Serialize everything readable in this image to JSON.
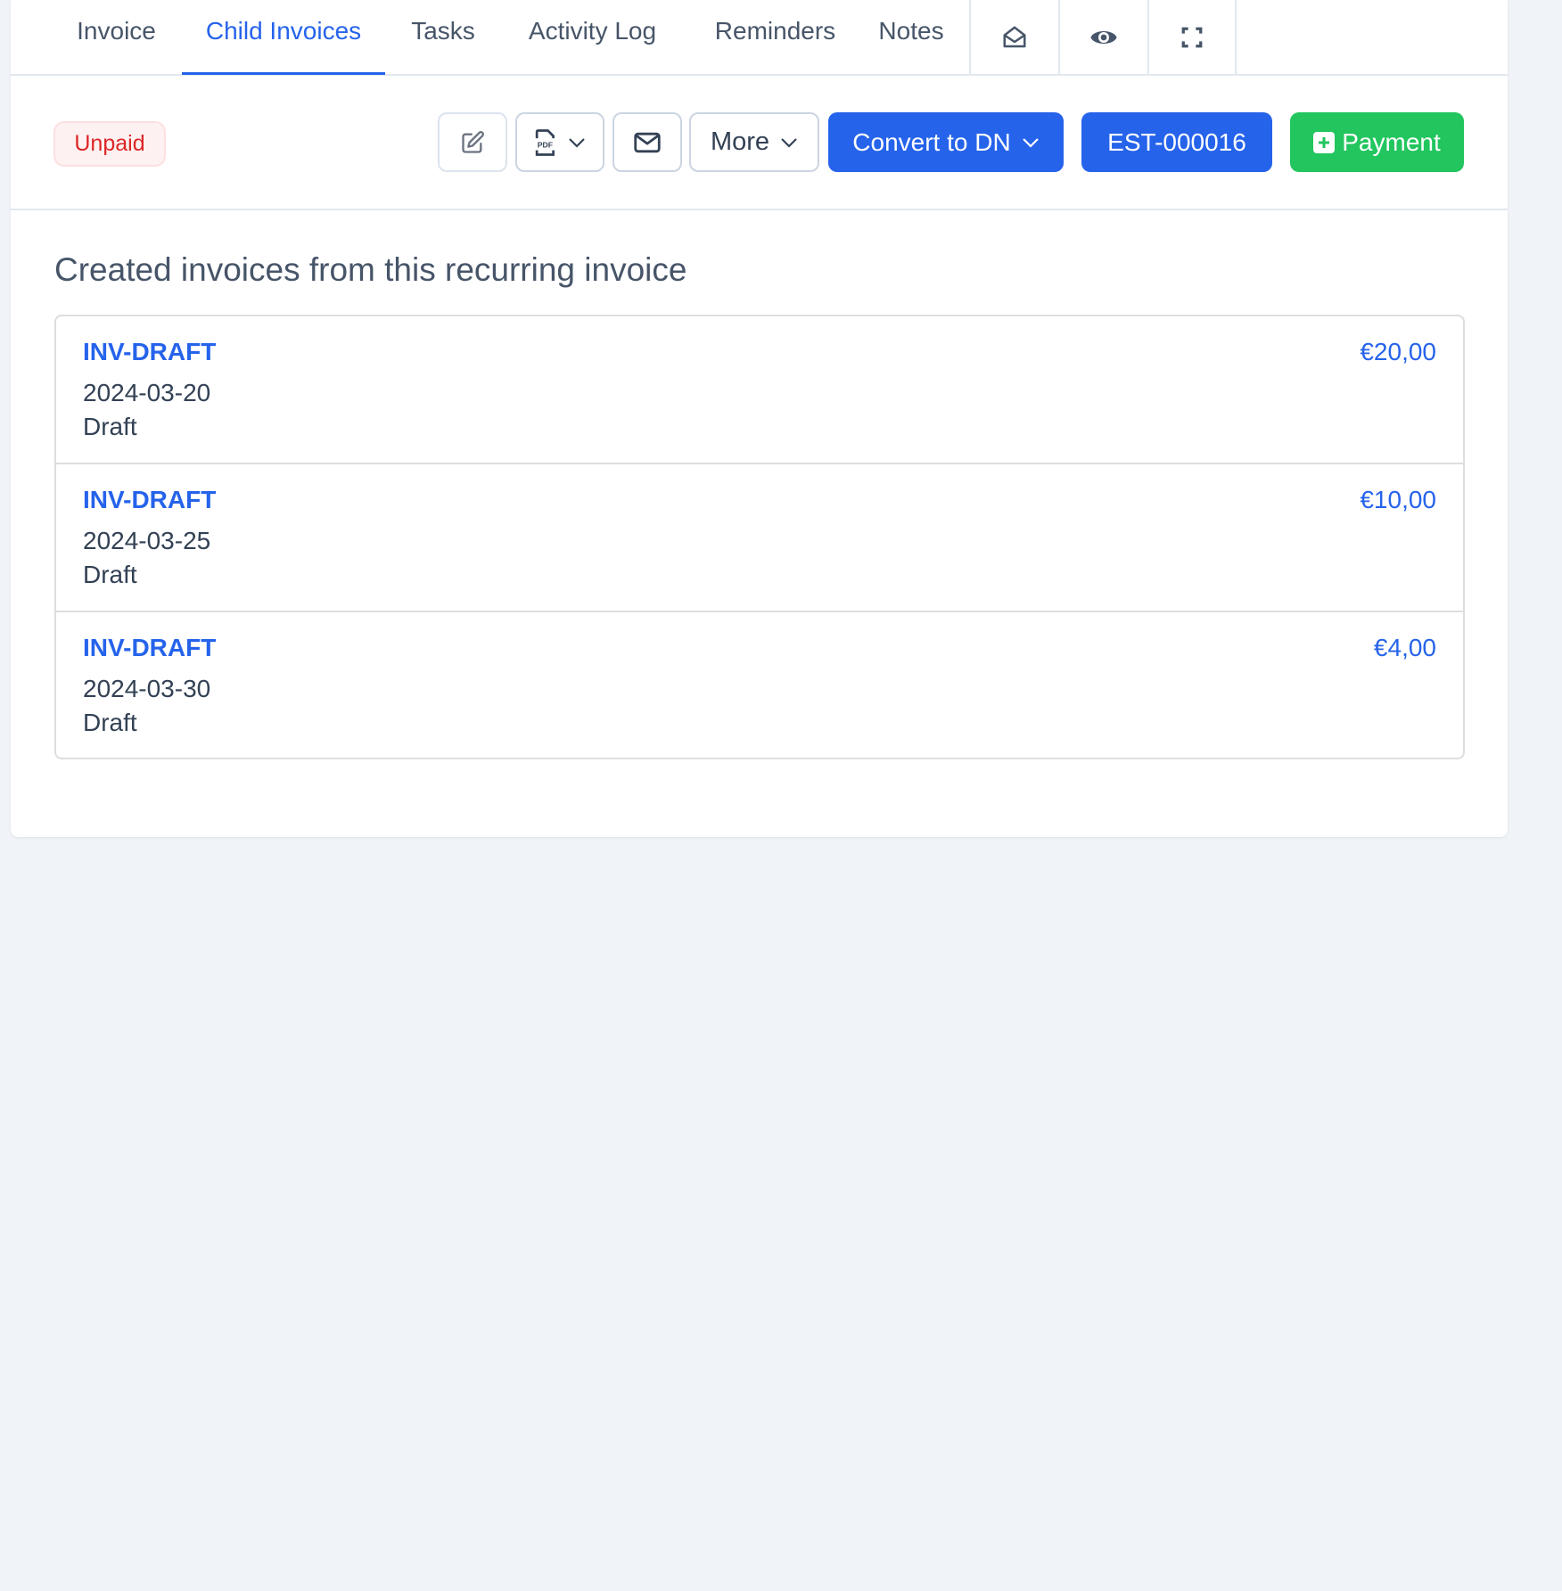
{
  "tabs": [
    {
      "label": "Invoice",
      "active": false
    },
    {
      "label": "Child Invoices",
      "active": true
    },
    {
      "label": "Tasks",
      "active": false
    },
    {
      "label": "Activity Log",
      "active": false
    },
    {
      "label": "Reminders",
      "active": false
    },
    {
      "label": "Notes",
      "active": false
    }
  ],
  "tab_icons": [
    "envelope-open-icon",
    "eye-icon",
    "fullscreen-icon"
  ],
  "toolbar": {
    "status_badge": "Unpaid",
    "more_label": "More",
    "convert_label": "Convert to DN",
    "estimate_label": "EST-000016",
    "payment_label": "Payment"
  },
  "section": {
    "heading": "Created invoices from this recurring invoice"
  },
  "invoices": [
    {
      "number": "INV-DRAFT",
      "date": "2024-03-20",
      "status": "Draft",
      "amount": "€20,00"
    },
    {
      "number": "INV-DRAFT",
      "date": "2024-03-25",
      "status": "Draft",
      "amount": "€10,00"
    },
    {
      "number": "INV-DRAFT",
      "date": "2024-03-30",
      "status": "Draft",
      "amount": "€4,00"
    }
  ],
  "colors": {
    "accent": "#2563eb",
    "success": "#22c55e",
    "danger": "#dc2626",
    "background": "#f0f3f8"
  }
}
